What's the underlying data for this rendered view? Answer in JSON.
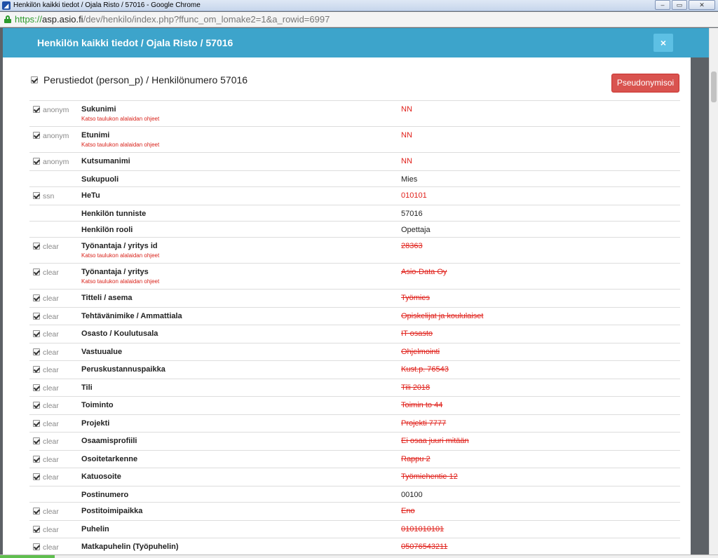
{
  "window": {
    "title": "Henkilön kaikki tiedot / Ojala Risto / 57016 - Google Chrome",
    "min_glyph": "–",
    "max_glyph": "▭",
    "close_glyph": "✕"
  },
  "address": {
    "scheme": "https://",
    "host": "asp.asio.fi",
    "path": "/dev/henkilo/index.php?ffunc_om_lomake2=1&a_rowid=6997"
  },
  "modal": {
    "title": "Henkilön kaikki tiedot / Ojala Risto / 57016",
    "close_glyph": "×",
    "section_title": "Perustiedot (person_p) / Henkilönumero 57016",
    "pseudo_button": "Pseudonymisoi"
  },
  "accent_colors": {
    "header": "#3da4cb",
    "danger": "#d9534f",
    "value_red": "#e0201a"
  },
  "rows": [
    {
      "checked": true,
      "tag": "anonym",
      "label": "Sukunimi",
      "hint": "Katso taulukon alalaidan ohjeet",
      "value": "NN",
      "style": "red"
    },
    {
      "checked": true,
      "tag": "anonym",
      "label": "Etunimi",
      "hint": "Katso taulukon alalaidan ohjeet",
      "value": "NN",
      "style": "red"
    },
    {
      "checked": true,
      "tag": "anonym",
      "label": "Kutsumanimi",
      "hint": "",
      "value": "NN",
      "style": "red"
    },
    {
      "checked": false,
      "tag": "",
      "label": "Sukupuoli",
      "hint": "",
      "value": "Mies",
      "style": "plain"
    },
    {
      "checked": true,
      "tag": "ssn",
      "label": "HeTu",
      "hint": "",
      "value": "010101",
      "style": "red"
    },
    {
      "checked": false,
      "tag": "",
      "label": "Henkilön tunniste",
      "hint": "",
      "value": "57016",
      "style": "plain"
    },
    {
      "checked": false,
      "tag": "",
      "label": "Henkilön rooli",
      "hint": "",
      "value": "Opettaja",
      "style": "plain"
    },
    {
      "checked": true,
      "tag": "clear",
      "label": "Työnantaja / yritys id",
      "hint": "Katso taulukon alalaidan ohjeet",
      "value": "28363",
      "style": "strike"
    },
    {
      "checked": true,
      "tag": "clear",
      "label": "Työnantaja / yritys",
      "hint": "Katso taulukon alalaidan ohjeet",
      "value": "Asio-Data Oy",
      "style": "strike"
    },
    {
      "checked": true,
      "tag": "clear",
      "label": "Titteli / asema",
      "hint": "",
      "value": "Työmies",
      "style": "strike"
    },
    {
      "checked": true,
      "tag": "clear",
      "label": "Tehtävänimike / Ammattiala",
      "hint": "",
      "value": "Opiskelijat ja koululaiset",
      "style": "strike"
    },
    {
      "checked": true,
      "tag": "clear",
      "label": "Osasto / Koulutusala",
      "hint": "",
      "value": "IT osasto",
      "style": "strike"
    },
    {
      "checked": true,
      "tag": "clear",
      "label": "Vastuualue",
      "hint": "",
      "value": "Ohjelmointi",
      "style": "strike"
    },
    {
      "checked": true,
      "tag": "clear",
      "label": "Peruskustannuspaikka",
      "hint": "",
      "value": "Kust.p. 76543",
      "style": "strike"
    },
    {
      "checked": true,
      "tag": "clear",
      "label": "Tili",
      "hint": "",
      "value": "Tili 2018",
      "style": "strike"
    },
    {
      "checked": true,
      "tag": "clear",
      "label": "Toiminto",
      "hint": "",
      "value": "Toimin to 44",
      "style": "strike"
    },
    {
      "checked": true,
      "tag": "clear",
      "label": "Projekti",
      "hint": "",
      "value": "Projekti 7777",
      "style": "strike"
    },
    {
      "checked": true,
      "tag": "clear",
      "label": "Osaamisprofiili",
      "hint": "",
      "value": "Ei osaa juuri mitään",
      "style": "strike"
    },
    {
      "checked": true,
      "tag": "clear",
      "label": "Osoitetarkenne",
      "hint": "",
      "value": "Rappu 2",
      "style": "strike"
    },
    {
      "checked": true,
      "tag": "clear",
      "label": "Katuosoite",
      "hint": "",
      "value": "Työmiehentie 12",
      "style": "strike"
    },
    {
      "checked": false,
      "tag": "",
      "label": "Postinumero",
      "hint": "",
      "value": "00100",
      "style": "plain"
    },
    {
      "checked": true,
      "tag": "clear",
      "label": "Postitoimipaikka",
      "hint": "",
      "value": "Eno",
      "style": "strike"
    },
    {
      "checked": true,
      "tag": "clear",
      "label": "Puhelin",
      "hint": "",
      "value": "0101010101",
      "style": "strike"
    },
    {
      "checked": true,
      "tag": "clear",
      "label": "Matkapuhelin (Työpuhelin)",
      "hint": "",
      "value": "05076543211",
      "style": "strike"
    }
  ]
}
